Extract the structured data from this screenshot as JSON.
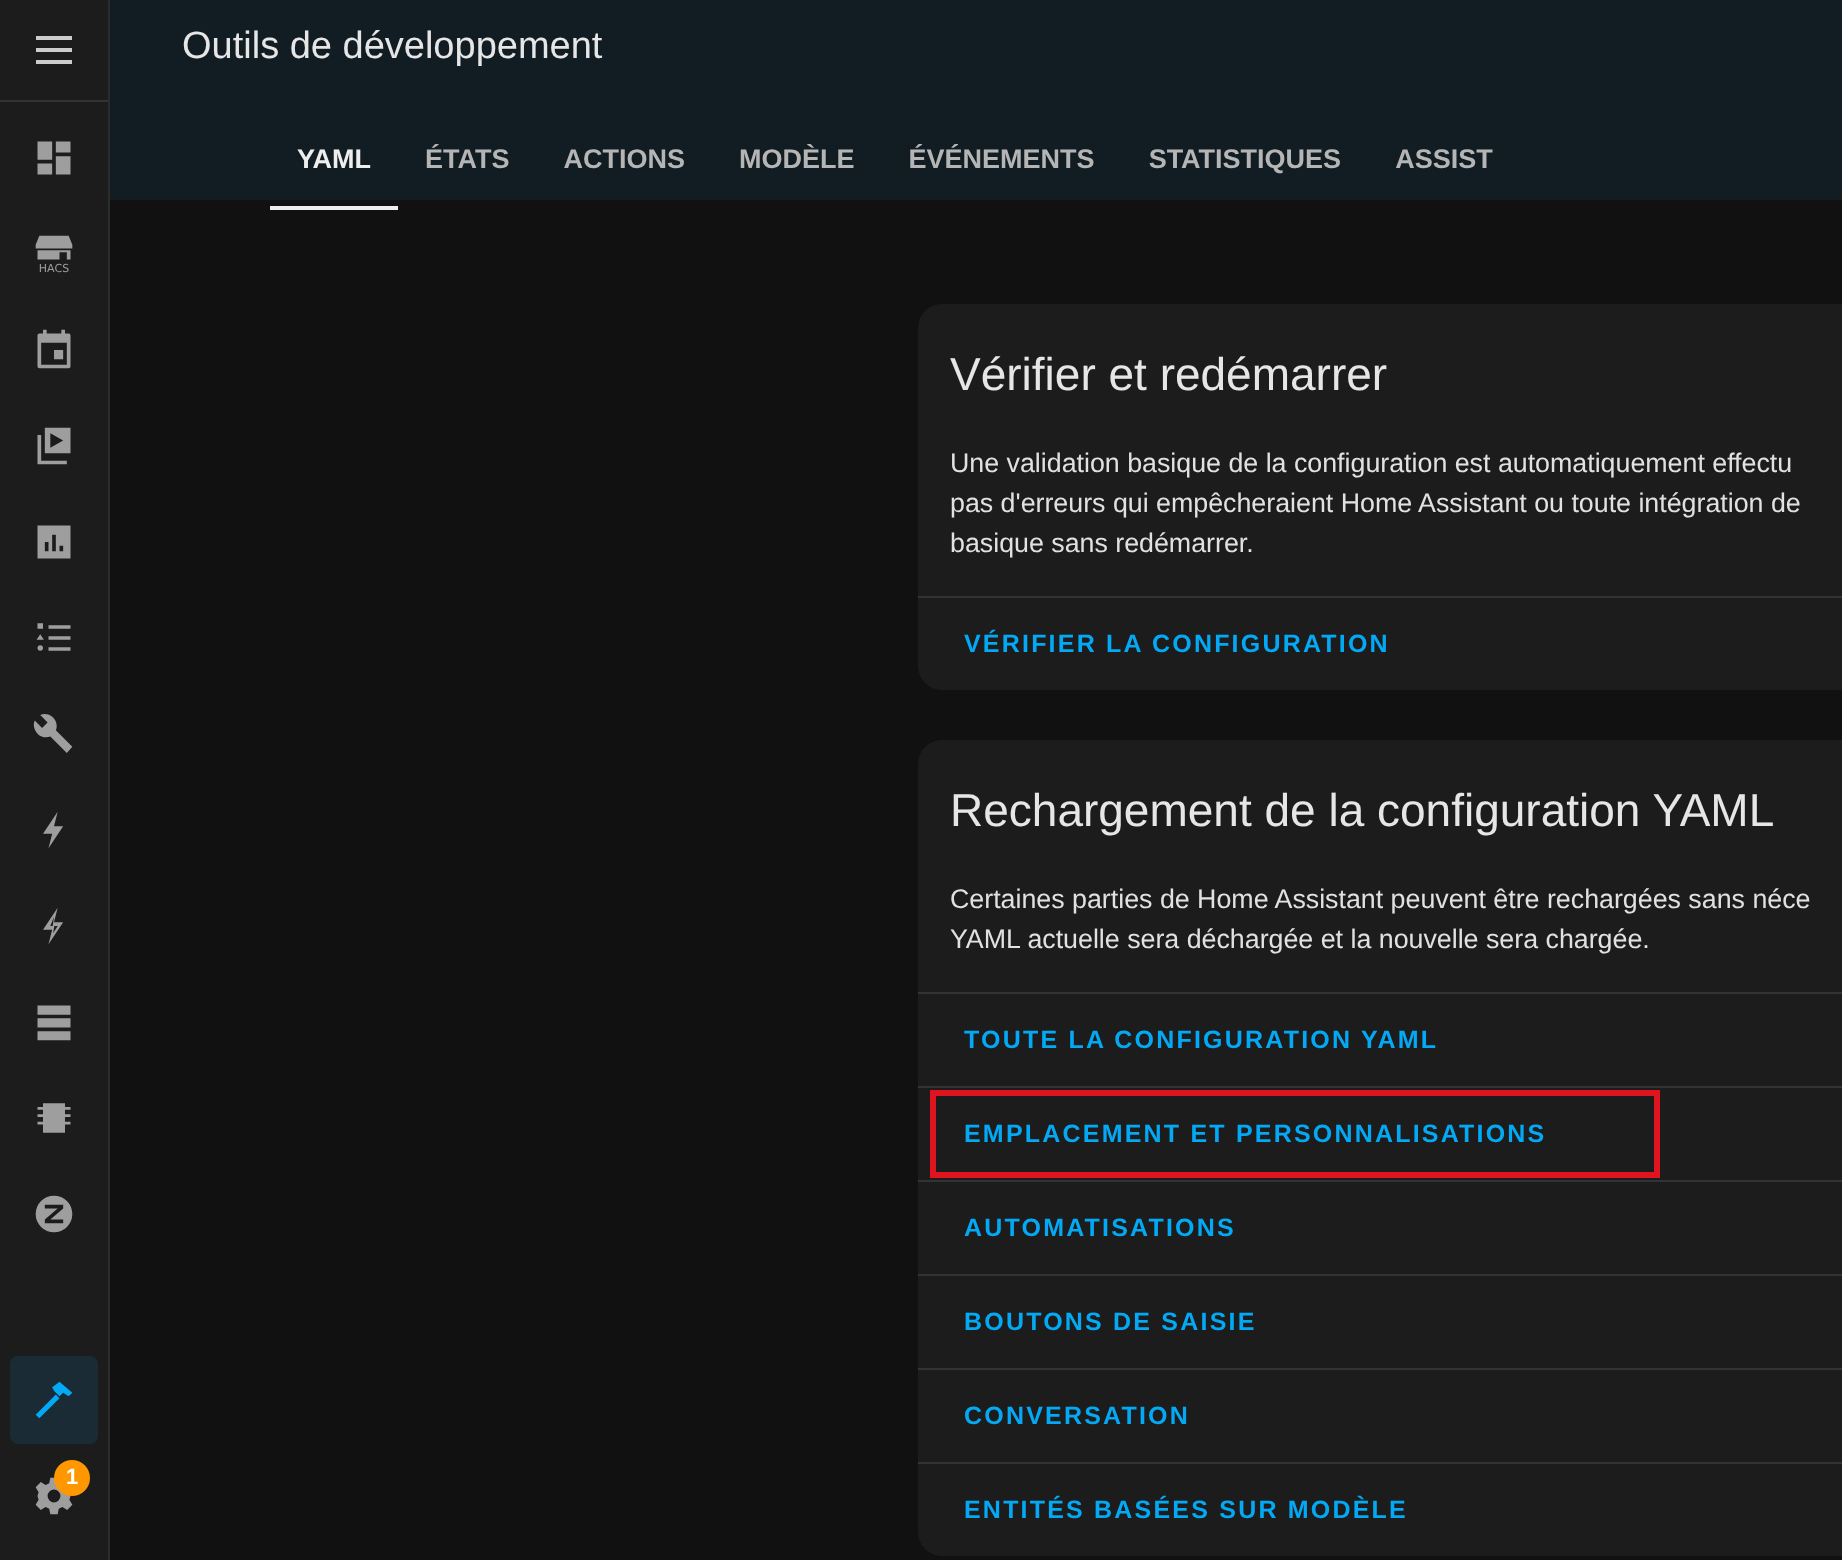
{
  "sidebar": {
    "items": [
      {
        "kind": "dashboard",
        "selected": false
      },
      {
        "kind": "store",
        "label": "HACS",
        "selected": false
      },
      {
        "kind": "calendar",
        "selected": false
      },
      {
        "kind": "media",
        "selected": false
      },
      {
        "kind": "chart",
        "selected": false
      },
      {
        "kind": "list",
        "selected": false
      },
      {
        "kind": "wrench",
        "selected": false
      },
      {
        "kind": "bolt",
        "selected": false
      },
      {
        "kind": "bolt-outline",
        "selected": false
      },
      {
        "kind": "server",
        "selected": false
      },
      {
        "kind": "chip",
        "selected": false
      },
      {
        "kind": "zwave",
        "selected": false
      }
    ],
    "bottom": [
      {
        "kind": "hammer",
        "selected": true
      },
      {
        "kind": "gear",
        "selected": false,
        "badge": "1"
      }
    ]
  },
  "header": {
    "title": "Outils de développement"
  },
  "tabs": [
    {
      "label": "YAML",
      "selected": true
    },
    {
      "label": "ÉTATS",
      "selected": false
    },
    {
      "label": "ACTIONS",
      "selected": false
    },
    {
      "label": "MODÈLE",
      "selected": false
    },
    {
      "label": "ÉVÉNEMENTS",
      "selected": false
    },
    {
      "label": "STATISTIQUES",
      "selected": false
    },
    {
      "label": "ASSIST",
      "selected": false
    }
  ],
  "cards": [
    {
      "title": "Vérifier et redémarrer",
      "description": [
        "Une validation basique de la configuration est automatiquement effectu",
        "pas d'erreurs qui empêcheraient Home Assistant ou toute intégration de",
        "basique sans redémarrer."
      ],
      "actions": [
        {
          "label": "VÉRIFIER LA CONFIGURATION",
          "highlighted": false
        }
      ]
    },
    {
      "title": "Rechargement de la configuration YAML",
      "description": [
        "Certaines parties de Home Assistant peuvent être rechargées sans néce",
        "YAML actuelle sera déchargée et la nouvelle sera chargée."
      ],
      "actions": [
        {
          "label": "TOUTE LA CONFIGURATION YAML",
          "highlighted": false
        },
        {
          "label": "EMPLACEMENT ET PERSONNALISATIONS",
          "highlighted": true
        },
        {
          "label": "AUTOMATISATIONS",
          "highlighted": false
        },
        {
          "label": "BOUTONS DE SAISIE",
          "highlighted": false
        },
        {
          "label": "CONVERSATION",
          "highlighted": false
        },
        {
          "label": "ENTITÉS BASÉES SUR MODÈLE",
          "highlighted": false
        }
      ]
    }
  ]
}
